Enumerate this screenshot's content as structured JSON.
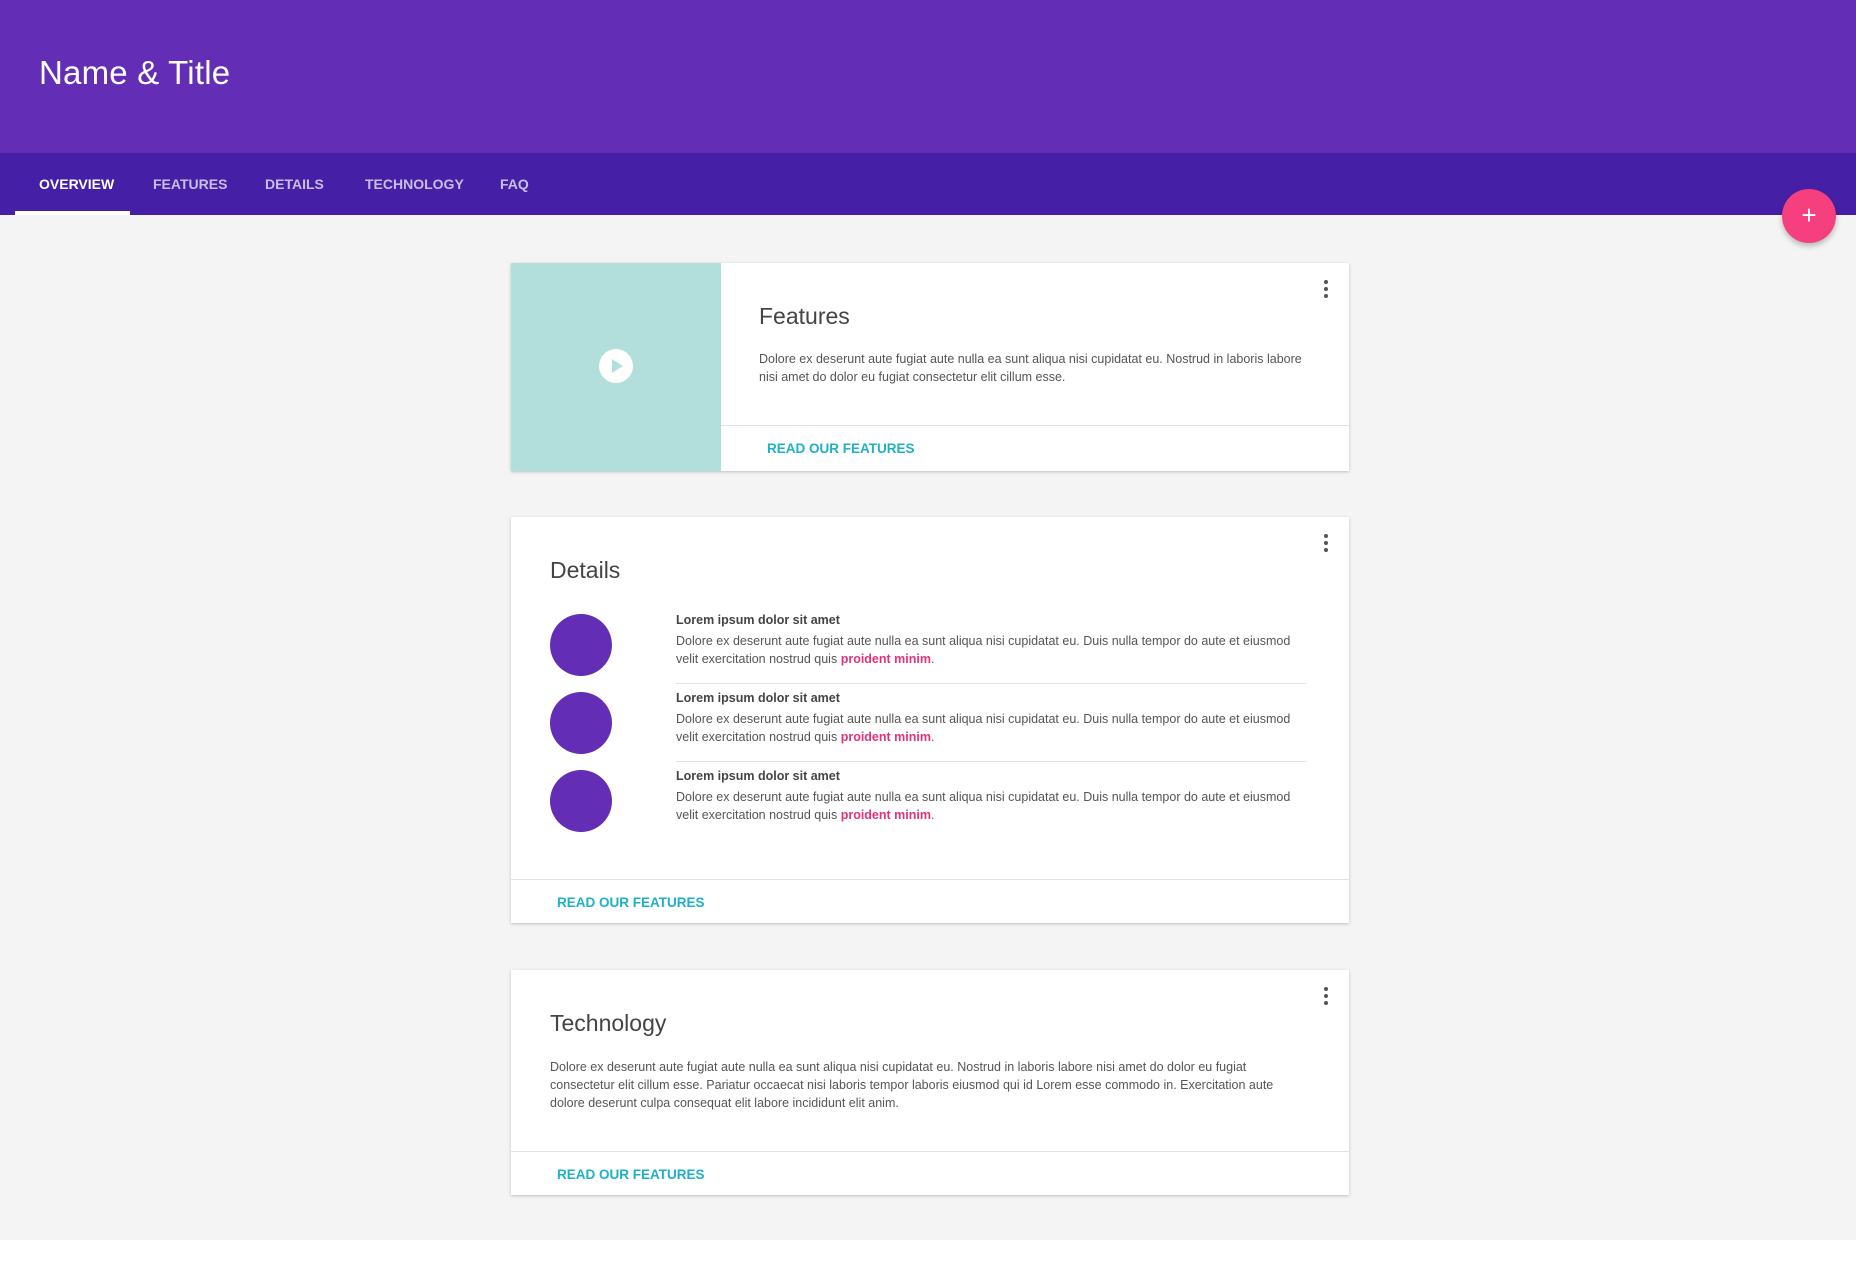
{
  "app": {
    "title": "Name & Title"
  },
  "tabs": [
    {
      "label": "OVERVIEW",
      "active": true
    },
    {
      "label": "FEATURES",
      "active": false
    },
    {
      "label": "DETAILS",
      "active": false
    },
    {
      "label": "TECHNOLOGY",
      "active": false
    },
    {
      "label": "FAQ",
      "active": false
    }
  ],
  "fab": {
    "icon": "plus-icon",
    "glyph": "+"
  },
  "colors": {
    "header": "#632eb5",
    "tabbar": "#4520a6",
    "accent": "#f53f7e",
    "link": "#1db1c7",
    "media": "#b2dfdc",
    "highlight": "#e2337a"
  },
  "features_card": {
    "title": "Features",
    "body": "Dolore ex deserunt aute fugiat aute nulla ea sunt aliqua nisi cupidatat eu. Nostrud in laboris labore nisi amet do dolor eu fugiat consectetur elit cillum esse.",
    "action": "READ OUR FEATURES",
    "media_icon": "play-icon"
  },
  "details_card": {
    "title": "Details",
    "items": [
      {
        "title": "Lorem ipsum dolor sit amet",
        "text": "Dolore ex deserunt aute fugiat aute nulla ea sunt aliqua nisi cupidatat eu. Duis nulla tempor do aute et eiusmod velit exercitation nostrud quis",
        "link": "proident minim",
        "suffix": "."
      },
      {
        "title": "Lorem ipsum dolor sit amet",
        "text": "Dolore ex deserunt aute fugiat aute nulla ea sunt aliqua nisi cupidatat eu. Duis nulla tempor do aute et eiusmod velit exercitation nostrud quis",
        "link": "proident minim",
        "suffix": "."
      },
      {
        "title": "Lorem ipsum dolor sit amet",
        "text": "Dolore ex deserunt aute fugiat aute nulla ea sunt aliqua nisi cupidatat eu. Duis nulla tempor do aute et eiusmod velit exercitation nostrud quis",
        "link": "proident minim",
        "suffix": "."
      }
    ],
    "action": "READ OUR FEATURES"
  },
  "technology_card": {
    "title": "Technology",
    "body": "Dolore ex deserunt aute fugiat aute nulla ea sunt aliqua nisi cupidatat eu. Nostrud in laboris labore nisi amet do dolor eu fugiat consectetur elit cillum esse. Pariatur occaecat nisi laboris tempor laboris eiusmod qui id Lorem esse commodo in. Exercitation aute dolore deserunt culpa consequat elit labore incididunt elit anim.",
    "action": "READ OUR FEATURES"
  }
}
